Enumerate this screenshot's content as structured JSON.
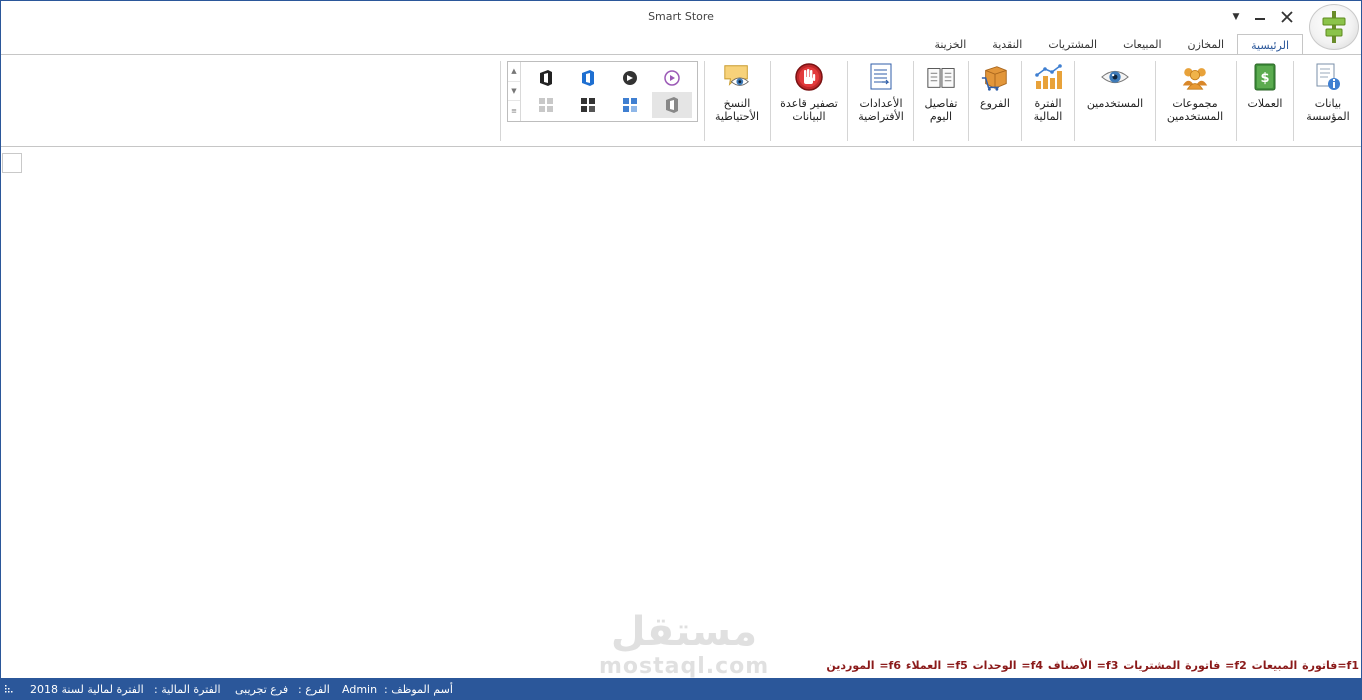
{
  "window": {
    "title": "Smart Store",
    "help_glyph": "▼",
    "accent": "#2b579a"
  },
  "tabs": [
    {
      "label": "الرئيسية",
      "active": true
    },
    {
      "label": "المخازن"
    },
    {
      "label": "المبيعات"
    },
    {
      "label": "المشتريات"
    },
    {
      "label": "النقدية"
    },
    {
      "label": "الخزينة"
    }
  ],
  "ribbon": {
    "buttons": {
      "org_info": "بيانات\nالمؤسسة",
      "currencies": "العملات",
      "user_groups": "مجموعات\nالمستخدمين",
      "users": "المستخدمين",
      "fiscal_period": "الفترة\nالمالية",
      "branches": "الفروع",
      "day_details": "تفاصيل\nاليوم",
      "default_settings": "الأعدادات\nالأفتراضية",
      "reset_db": "تصفير قاعدة\nالبيانات",
      "backup": "النسخ\nالأحتياطية"
    },
    "gallery": {
      "scroll_up": "▲",
      "scroll_down": "▼",
      "scroll_more": "≡"
    }
  },
  "shortcuts": "f1=فاتورة المبيعات   f2= فاتورة المشتريات   f3= الأصناف   f4= الوحدات   f5= العملاء   f6= الموردين",
  "watermark": {
    "arabic": "مستقل",
    "latin": "mostaql.com"
  },
  "status": {
    "employee_label": "أسم الموظف :",
    "employee_value": "Admin",
    "branch_label": "الفرع :",
    "branch_value": "فرع تجريبى",
    "period_label": "الفترة المالية :",
    "period_value": "الفترة لمالية لسنة 2018"
  }
}
